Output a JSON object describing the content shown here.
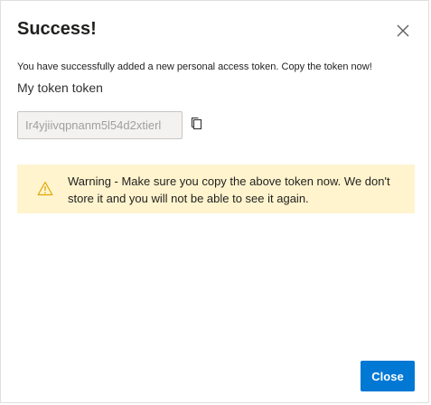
{
  "dialog": {
    "title": "Success!",
    "description": "You have successfully added a new personal access token. Copy the token now!",
    "token_name": "My token token",
    "token_value": "Ir4yjiivqpnanm5l54d2xtierl",
    "warning_text": "Warning - Make sure you copy the above token now. We don't store it and you will not be able to see it again.",
    "close_label": "Close"
  },
  "icons": {
    "close": "close-icon",
    "copy": "copy-icon",
    "warning": "warning-icon"
  },
  "colors": {
    "primary": "#0078d4",
    "warning_bg": "#fff4ce",
    "warning_icon": "#e0a800"
  }
}
